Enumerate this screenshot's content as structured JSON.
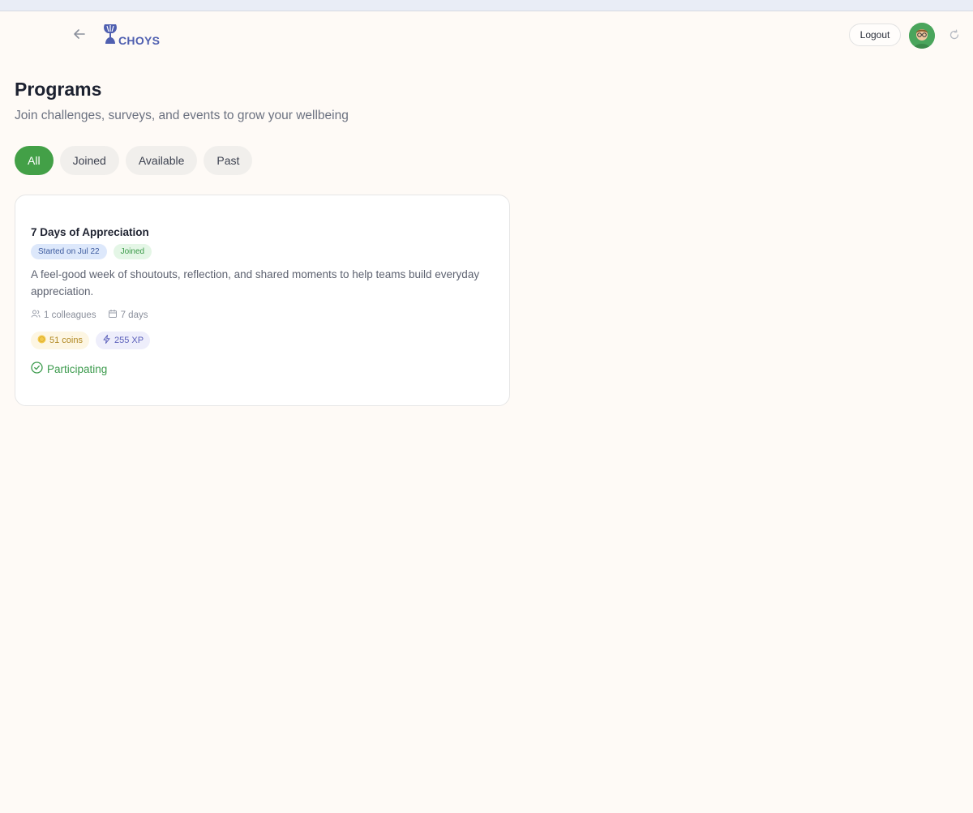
{
  "header": {
    "logo_text": "CHOYS",
    "logout_label": "Logout",
    "back_icon": "arrow-left-icon",
    "refresh_icon": "refresh-icon"
  },
  "page": {
    "title": "Programs",
    "subtitle": "Join challenges, surveys, and events to grow your wellbeing"
  },
  "tabs": [
    {
      "label": "All",
      "active": true
    },
    {
      "label": "Joined",
      "active": false
    },
    {
      "label": "Available",
      "active": false
    },
    {
      "label": "Past",
      "active": false
    }
  ],
  "programs": [
    {
      "title": "7 Days of Appreciation",
      "start_badge": "Started on Jul 22",
      "joined_badge": "Joined",
      "description": "A feel-good week of shoutouts, reflection, and shared moments to help teams build everyday appreciation.",
      "colleagues": "1 colleagues",
      "duration": "7 days",
      "coins": "51 coins",
      "xp": "255 XP",
      "status": "Participating"
    }
  ],
  "colors": {
    "accent": "#43a047",
    "background": "#fefaf6",
    "logo": "#4f5fb0"
  }
}
